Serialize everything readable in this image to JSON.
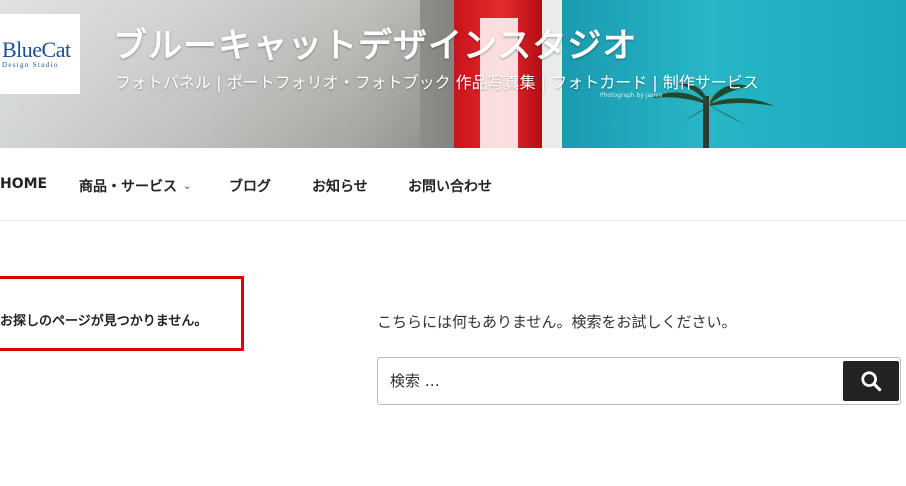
{
  "header": {
    "logo": {
      "main": "BlueCat",
      "sub": "Design Studio"
    },
    "site_title": "ブルーキャットデザインスタジオ",
    "tagline": "フォトパネル | ポートフォリオ・フォトブック 作品写真集 | フォトカード | 制作サービス",
    "photo_credit": "Photograph by jamie"
  },
  "nav": {
    "items": [
      {
        "label": "HOME"
      },
      {
        "label": "商品・サービス",
        "has_dropdown": true
      },
      {
        "label": "ブログ"
      },
      {
        "label": "お知らせ"
      },
      {
        "label": "お問い合わせ"
      }
    ],
    "dropdown_icon": "chevron-down-icon"
  },
  "content": {
    "not_found_title": "お探しのページが見つかりません。",
    "message": "こちらには何もありません。検索をお試しください。",
    "search": {
      "placeholder": "検索 …",
      "button_icon": "search-icon"
    }
  },
  "colors": {
    "highlight_border": "#e00000",
    "search_button": "#222222",
    "logo_text": "#1f4f8f"
  }
}
